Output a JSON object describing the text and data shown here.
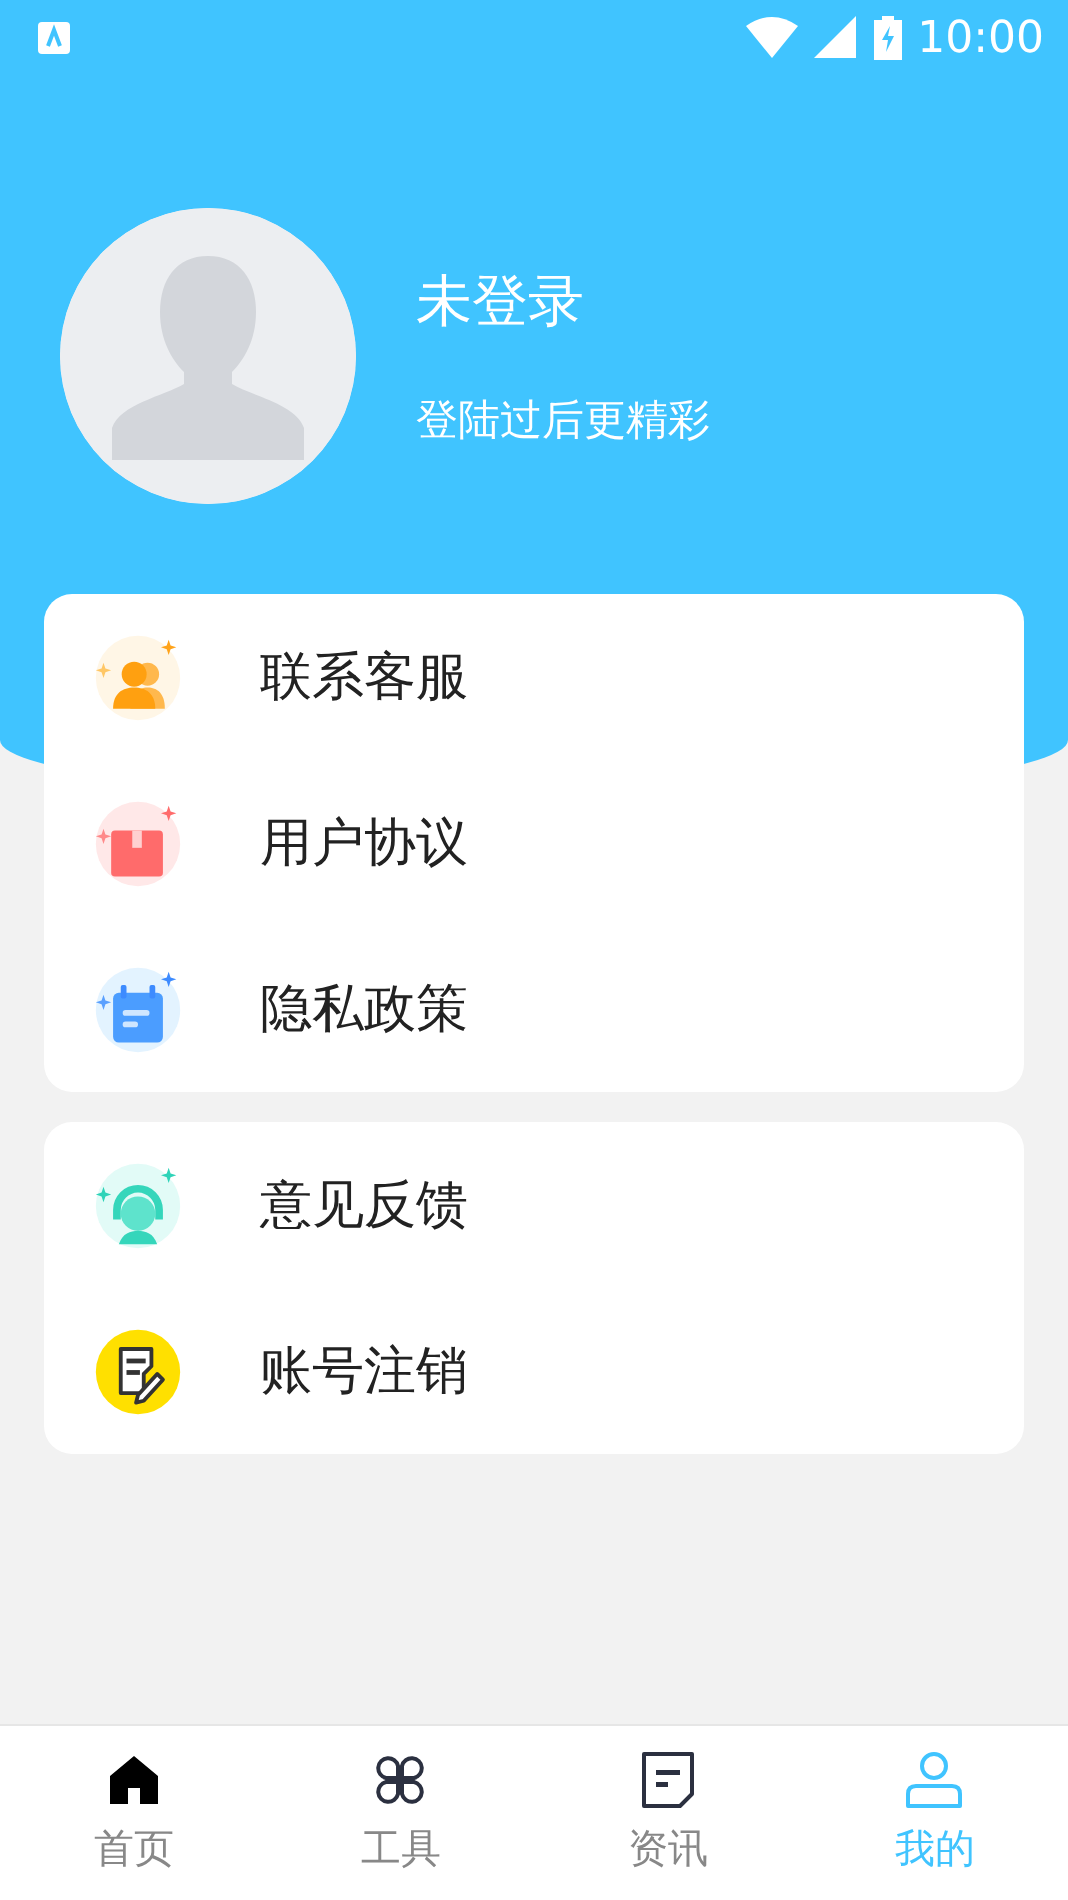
{
  "status_bar": {
    "time": "10:00"
  },
  "profile": {
    "name": "未登录",
    "subtitle": "登陆过后更精彩"
  },
  "menu_groups": [
    {
      "items": [
        {
          "kind": "support",
          "label": "联系客服"
        },
        {
          "kind": "agreement",
          "label": "用户协议"
        },
        {
          "kind": "privacy",
          "label": "隐私政策"
        }
      ]
    },
    {
      "items": [
        {
          "kind": "feedback",
          "label": "意见反馈"
        },
        {
          "kind": "cancel",
          "label": "账号注销"
        }
      ]
    }
  ],
  "tab_bar": [
    {
      "kind": "home",
      "label": "首页",
      "selected": false
    },
    {
      "kind": "tools",
      "label": "工具",
      "selected": false
    },
    {
      "kind": "news",
      "label": "资讯",
      "selected": false
    },
    {
      "kind": "me",
      "label": "我的",
      "selected": true
    }
  ]
}
